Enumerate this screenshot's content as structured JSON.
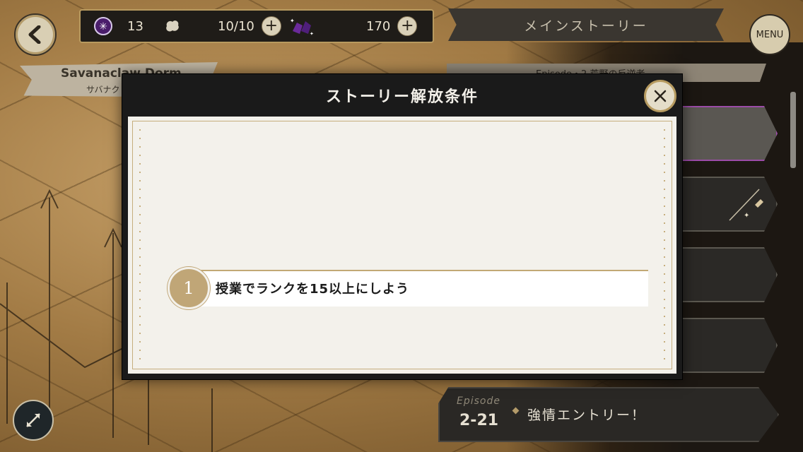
{
  "header": {
    "resources": [
      {
        "name": "gem",
        "value": "13"
      },
      {
        "name": "stamina",
        "value": "10/10"
      },
      {
        "name": "crystal",
        "value": "170"
      }
    ],
    "main_story_label": "メインストーリー",
    "menu_label": "MENU"
  },
  "location": {
    "name": "Savanaclaw Dorm",
    "sub": "サバナク"
  },
  "episode_strip": {
    "label": "Episode・2 荒野の反逆者"
  },
  "modal": {
    "title": "ストーリー解放条件",
    "conditions": [
      {
        "number": "1",
        "text": "授業でランクを15以上にしよう"
      }
    ]
  },
  "episode_card": {
    "label": "Episode",
    "number": "2-21",
    "title": "強情エントリー！"
  },
  "colors": {
    "gold": "#b89a5f",
    "active_border": "#9b4ca8",
    "modal_bg": "#1a1a1a",
    "paper": "#f3f1eb"
  }
}
